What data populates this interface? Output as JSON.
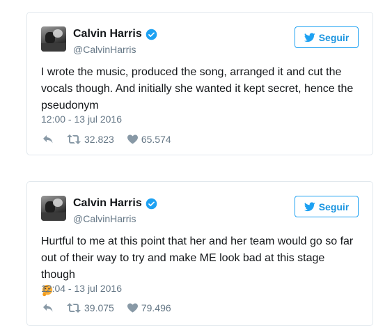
{
  "tweets": [
    {
      "display_name": "Calvin Harris",
      "handle": "@CalvinHarris",
      "follow_label": "Seguir",
      "text": "I wrote the music, produced the song, arranged it and cut the vocals though. And initially she wanted it kept secret, hence the pseudonym",
      "emoji": null,
      "timestamp": "12:00 - 13 jul 2016",
      "retweets": "32.823",
      "likes": "65.574"
    },
    {
      "display_name": "Calvin Harris",
      "handle": "@CalvinHarris",
      "follow_label": "Seguir",
      "text": "Hurtful to me at this point that her and her team would go so far out of their way to try and make ME look bad at this stage though",
      "emoji": "thinking-face-icon",
      "timestamp": "12:04 - 13 jul 2016",
      "retweets": "39.075",
      "likes": "79.496"
    }
  ],
  "colors": {
    "accent": "#1da1f2",
    "muted": "#657786",
    "border": "#e1e8ed",
    "text": "#14171a"
  },
  "icons": {
    "verified": "verified-badge-icon",
    "follow": "twitter-bird-icon",
    "reply": "reply-icon",
    "retweet": "retweet-icon",
    "like": "heart-icon"
  }
}
